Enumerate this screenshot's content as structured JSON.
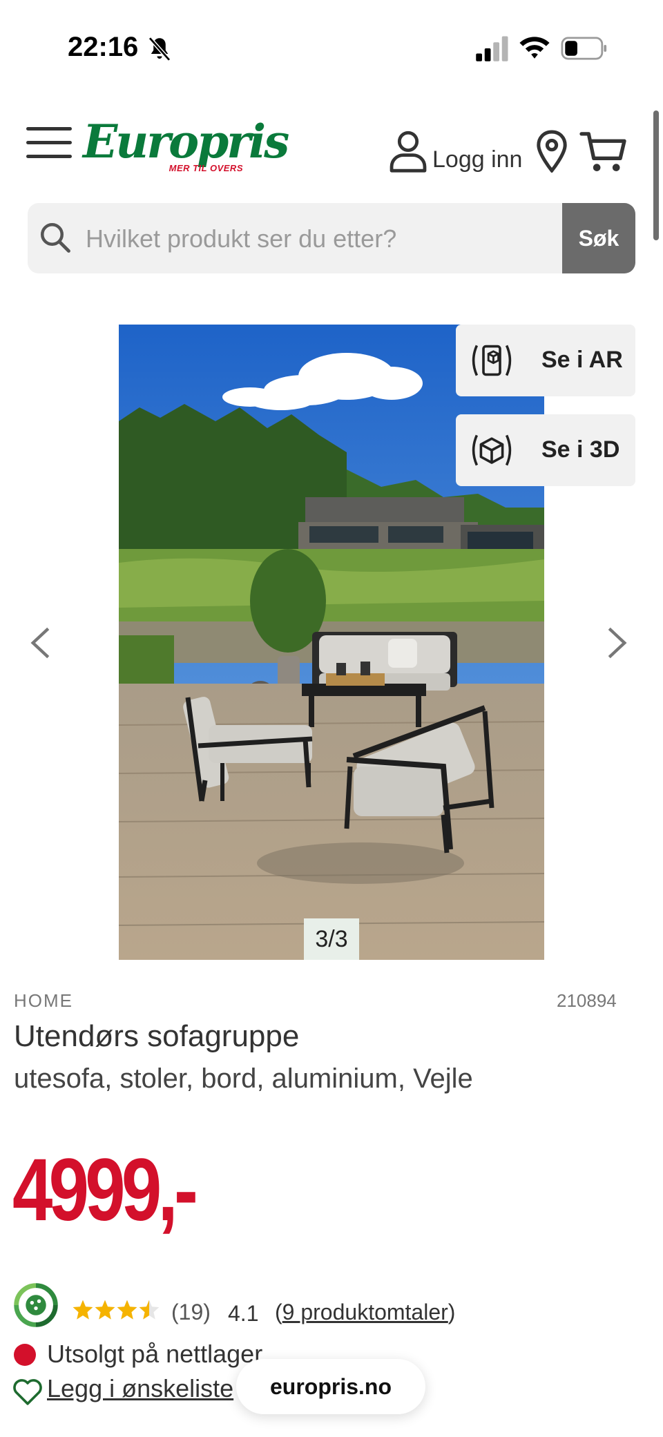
{
  "status_bar": {
    "time": "22:16"
  },
  "header": {
    "logo_text": "Europris",
    "logo_tagline": "MER TIL OVERS",
    "login_label": "Logg inn"
  },
  "search": {
    "placeholder": "Hvilket produkt ser du etter?",
    "button_label": "Søk"
  },
  "gallery": {
    "counter": "3/3",
    "ar_label": "Se i AR",
    "threed_label": "Se i 3D"
  },
  "product": {
    "brand": "HOME",
    "sku": "210894",
    "title": "Utendørs sofagruppe",
    "subtitle": "utesofa, stoler, bord, aluminium, Vejle",
    "price": "4999,-"
  },
  "rating": {
    "stars": 3.5,
    "count": "(19)",
    "value": "4.1",
    "reviews_open": "(",
    "reviews_text": "9 produktomtaler",
    "reviews_close": ")"
  },
  "availability": {
    "text": "Utsolgt på nettlager"
  },
  "wishlist": {
    "label": "Legg i ønskeliste"
  },
  "browser": {
    "url": "europris.no"
  },
  "colors": {
    "brand_green": "#0a7a3b",
    "price_red": "#d3102b",
    "search_button": "#6b6b6b",
    "star": "#f5b301"
  }
}
